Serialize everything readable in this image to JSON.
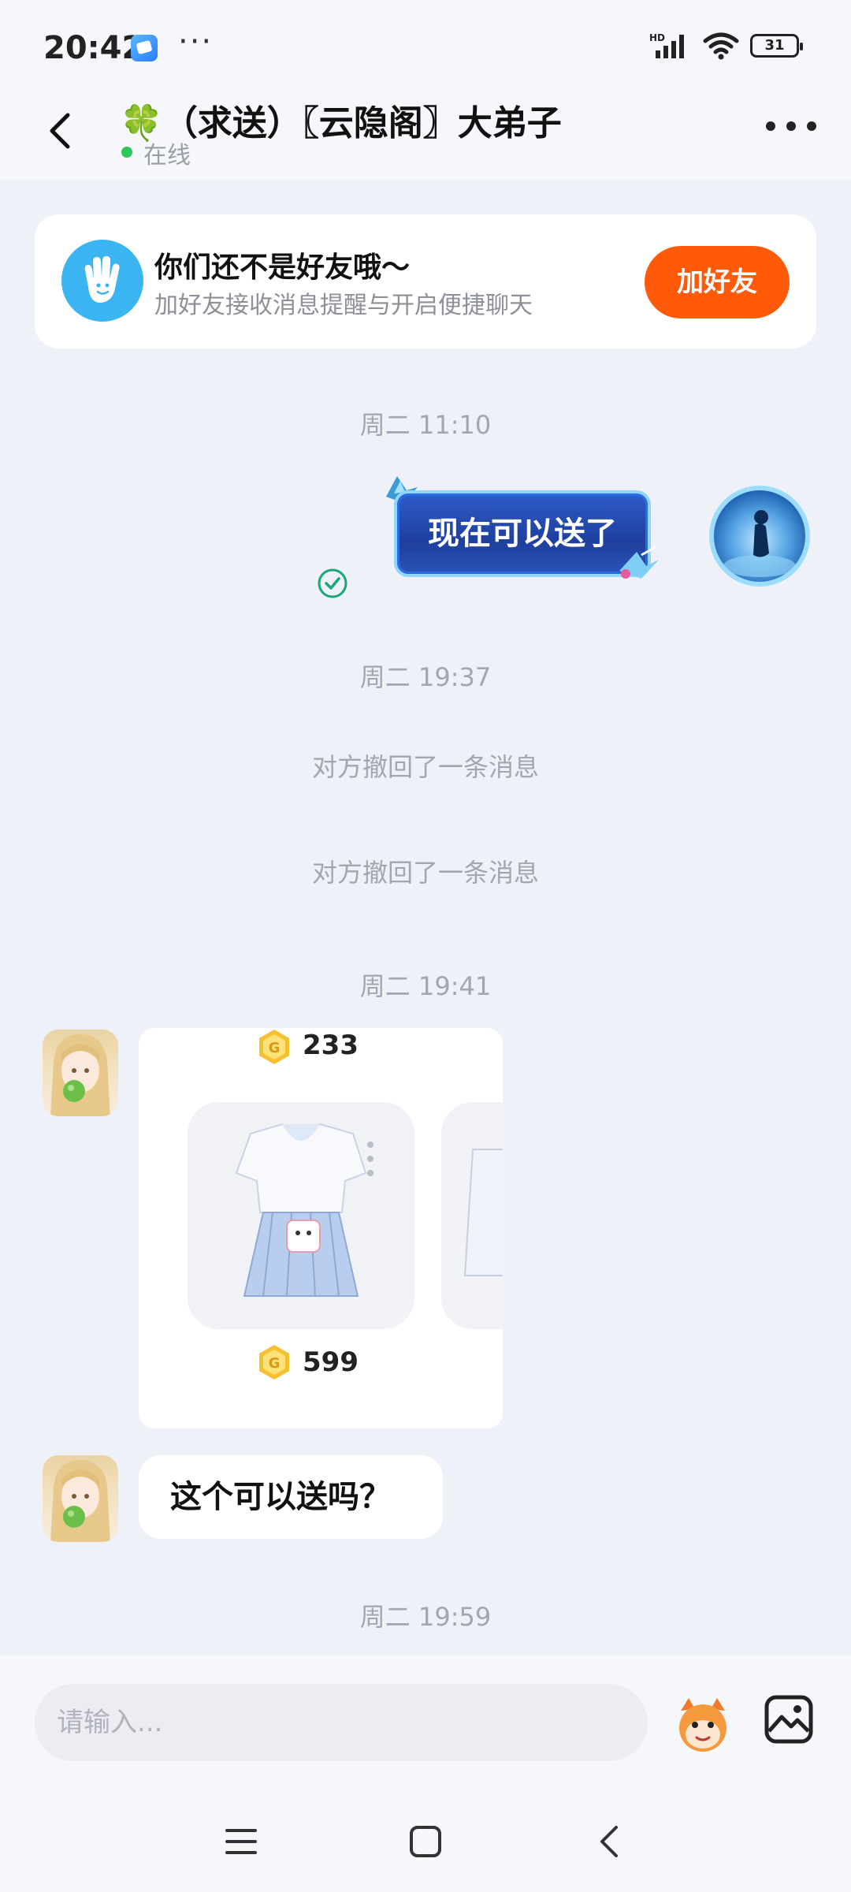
{
  "status_bar": {
    "time": "20:42",
    "dots": "···",
    "network": "HD",
    "battery": "31"
  },
  "header": {
    "title": "🍀（求送）〖云隐阁〗大弟子",
    "status": "在线"
  },
  "friend_banner": {
    "title": "你们还不是好友哦～",
    "subtitle": "加好友接收消息提醒与开启便捷聊天",
    "button": "加好友"
  },
  "messages": {
    "ts1": "周二 11:10",
    "sent_text": "现在可以送了",
    "ts2": "周二 19:37",
    "recall1": "对方撤回了一条消息",
    "recall2": "对方撤回了一条消息",
    "ts3": "周二 19:41",
    "card": {
      "price_top": "233",
      "price_item": "599"
    },
    "received_text": "这个可以送吗？",
    "ts4": "周二 19:59"
  },
  "input": {
    "placeholder": "请输入..."
  },
  "colors": {
    "accent": "#ff5a0a",
    "online": "#2fc65a",
    "banner_icon": "#3bb4f2"
  },
  "icons": [
    "back-icon",
    "more-icon",
    "wave-hand-icon",
    "read-check-icon",
    "coin-icon",
    "emoji-icon",
    "image-icon",
    "menu-icon",
    "home-icon",
    "nav-back-icon"
  ]
}
